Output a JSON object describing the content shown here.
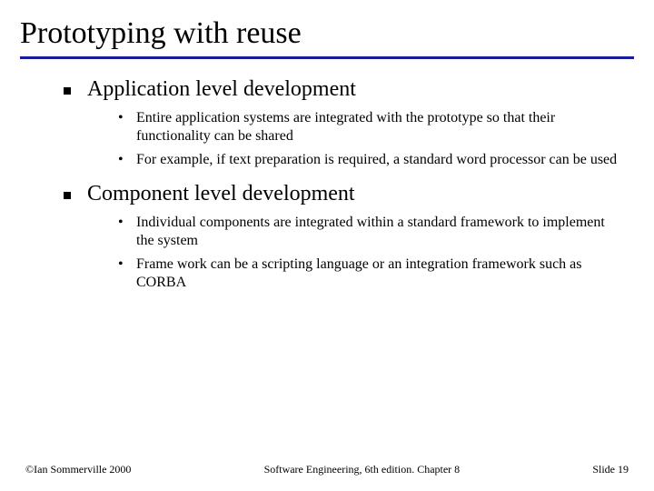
{
  "title": "Prototyping with reuse",
  "sections": [
    {
      "heading": "Application level development",
      "items": [
        "Entire application systems are integrated with the prototype so that their functionality can be shared",
        "For example, if text preparation is required, a standard word processor can be used"
      ]
    },
    {
      "heading": "Component level development",
      "items": [
        "Individual components are integrated within a standard framework to implement the system",
        "Frame work can be a scripting language or an integration framework such as CORBA"
      ]
    }
  ],
  "footer": {
    "left": "©Ian Sommerville 2000",
    "center": "Software Engineering, 6th edition. Chapter 8",
    "right": "Slide 19"
  }
}
